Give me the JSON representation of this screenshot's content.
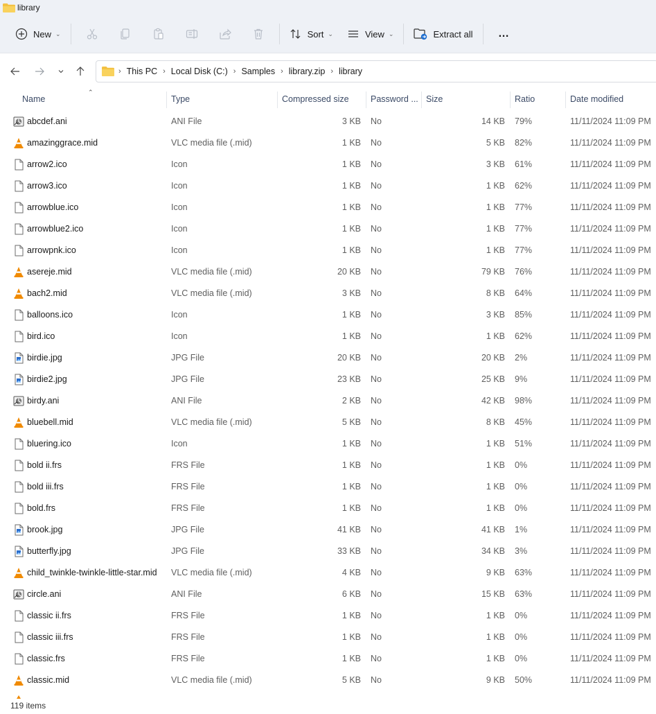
{
  "window": {
    "title": "library"
  },
  "toolbar": {
    "new_label": "New",
    "sort_label": "Sort",
    "view_label": "View",
    "extract_label": "Extract all",
    "more_label": "…"
  },
  "address": {
    "crumbs": [
      "This PC",
      "Local Disk (C:)",
      "Samples",
      "library.zip",
      "library"
    ]
  },
  "columns": {
    "name": "Name",
    "type": "Type",
    "compressed": "Compressed size",
    "password": "Password ...",
    "size": "Size",
    "ratio": "Ratio",
    "date": "Date modified"
  },
  "files": [
    {
      "name": "abcdef.ani",
      "icon": "ani",
      "type": "ANI File",
      "compressed": "3 KB",
      "password": "No",
      "size": "14 KB",
      "ratio": "79%",
      "date": "11/11/2024 11:09 PM"
    },
    {
      "name": "amazinggrace.mid",
      "icon": "vlc",
      "type": "VLC media file (.mid)",
      "compressed": "1 KB",
      "password": "No",
      "size": "5 KB",
      "ratio": "82%",
      "date": "11/11/2024 11:09 PM"
    },
    {
      "name": "arrow2.ico",
      "icon": "doc",
      "type": "Icon",
      "compressed": "1 KB",
      "password": "No",
      "size": "3 KB",
      "ratio": "61%",
      "date": "11/11/2024 11:09 PM"
    },
    {
      "name": "arrow3.ico",
      "icon": "doc",
      "type": "Icon",
      "compressed": "1 KB",
      "password": "No",
      "size": "1 KB",
      "ratio": "62%",
      "date": "11/11/2024 11:09 PM"
    },
    {
      "name": "arrowblue.ico",
      "icon": "doc",
      "type": "Icon",
      "compressed": "1 KB",
      "password": "No",
      "size": "1 KB",
      "ratio": "77%",
      "date": "11/11/2024 11:09 PM"
    },
    {
      "name": "arrowblue2.ico",
      "icon": "doc",
      "type": "Icon",
      "compressed": "1 KB",
      "password": "No",
      "size": "1 KB",
      "ratio": "77%",
      "date": "11/11/2024 11:09 PM"
    },
    {
      "name": "arrowpnk.ico",
      "icon": "doc",
      "type": "Icon",
      "compressed": "1 KB",
      "password": "No",
      "size": "1 KB",
      "ratio": "77%",
      "date": "11/11/2024 11:09 PM"
    },
    {
      "name": "asereje.mid",
      "icon": "vlc",
      "type": "VLC media file (.mid)",
      "compressed": "20 KB",
      "password": "No",
      "size": "79 KB",
      "ratio": "76%",
      "date": "11/11/2024 11:09 PM"
    },
    {
      "name": "bach2.mid",
      "icon": "vlc",
      "type": "VLC media file (.mid)",
      "compressed": "3 KB",
      "password": "No",
      "size": "8 KB",
      "ratio": "64%",
      "date": "11/11/2024 11:09 PM"
    },
    {
      "name": "balloons.ico",
      "icon": "doc",
      "type": "Icon",
      "compressed": "1 KB",
      "password": "No",
      "size": "3 KB",
      "ratio": "85%",
      "date": "11/11/2024 11:09 PM"
    },
    {
      "name": "bird.ico",
      "icon": "doc",
      "type": "Icon",
      "compressed": "1 KB",
      "password": "No",
      "size": "1 KB",
      "ratio": "62%",
      "date": "11/11/2024 11:09 PM"
    },
    {
      "name": "birdie.jpg",
      "icon": "jpg",
      "type": "JPG File",
      "compressed": "20 KB",
      "password": "No",
      "size": "20 KB",
      "ratio": "2%",
      "date": "11/11/2024 11:09 PM"
    },
    {
      "name": "birdie2.jpg",
      "icon": "jpg",
      "type": "JPG File",
      "compressed": "23 KB",
      "password": "No",
      "size": "25 KB",
      "ratio": "9%",
      "date": "11/11/2024 11:09 PM"
    },
    {
      "name": "birdy.ani",
      "icon": "ani",
      "type": "ANI File",
      "compressed": "2 KB",
      "password": "No",
      "size": "42 KB",
      "ratio": "98%",
      "date": "11/11/2024 11:09 PM"
    },
    {
      "name": "bluebell.mid",
      "icon": "vlc",
      "type": "VLC media file (.mid)",
      "compressed": "5 KB",
      "password": "No",
      "size": "8 KB",
      "ratio": "45%",
      "date": "11/11/2024 11:09 PM"
    },
    {
      "name": "bluering.ico",
      "icon": "doc",
      "type": "Icon",
      "compressed": "1 KB",
      "password": "No",
      "size": "1 KB",
      "ratio": "51%",
      "date": "11/11/2024 11:09 PM"
    },
    {
      "name": "bold ii.frs",
      "icon": "doc",
      "type": "FRS File",
      "compressed": "1 KB",
      "password": "No",
      "size": "1 KB",
      "ratio": "0%",
      "date": "11/11/2024 11:09 PM"
    },
    {
      "name": "bold iii.frs",
      "icon": "doc",
      "type": "FRS File",
      "compressed": "1 KB",
      "password": "No",
      "size": "1 KB",
      "ratio": "0%",
      "date": "11/11/2024 11:09 PM"
    },
    {
      "name": "bold.frs",
      "icon": "doc",
      "type": "FRS File",
      "compressed": "1 KB",
      "password": "No",
      "size": "1 KB",
      "ratio": "0%",
      "date": "11/11/2024 11:09 PM"
    },
    {
      "name": "brook.jpg",
      "icon": "jpg",
      "type": "JPG File",
      "compressed": "41 KB",
      "password": "No",
      "size": "41 KB",
      "ratio": "1%",
      "date": "11/11/2024 11:09 PM"
    },
    {
      "name": "butterfly.jpg",
      "icon": "jpg",
      "type": "JPG File",
      "compressed": "33 KB",
      "password": "No",
      "size": "34 KB",
      "ratio": "3%",
      "date": "11/11/2024 11:09 PM"
    },
    {
      "name": "child_twinkle-twinkle-little-star.mid",
      "icon": "vlc",
      "type": "VLC media file (.mid)",
      "compressed": "4 KB",
      "password": "No",
      "size": "9 KB",
      "ratio": "63%",
      "date": "11/11/2024 11:09 PM"
    },
    {
      "name": "circle.ani",
      "icon": "ani",
      "type": "ANI File",
      "compressed": "6 KB",
      "password": "No",
      "size": "15 KB",
      "ratio": "63%",
      "date": "11/11/2024 11:09 PM"
    },
    {
      "name": "classic ii.frs",
      "icon": "doc",
      "type": "FRS File",
      "compressed": "1 KB",
      "password": "No",
      "size": "1 KB",
      "ratio": "0%",
      "date": "11/11/2024 11:09 PM"
    },
    {
      "name": "classic iii.frs",
      "icon": "doc",
      "type": "FRS File",
      "compressed": "1 KB",
      "password": "No",
      "size": "1 KB",
      "ratio": "0%",
      "date": "11/11/2024 11:09 PM"
    },
    {
      "name": "classic.frs",
      "icon": "doc",
      "type": "FRS File",
      "compressed": "1 KB",
      "password": "No",
      "size": "1 KB",
      "ratio": "0%",
      "date": "11/11/2024 11:09 PM"
    },
    {
      "name": "classic.mid",
      "icon": "vlc",
      "type": "VLC media file (.mid)",
      "compressed": "5 KB",
      "password": "No",
      "size": "9 KB",
      "ratio": "50%",
      "date": "11/11/2024 11:09 PM"
    }
  ],
  "status": {
    "item_count": "119 items"
  }
}
